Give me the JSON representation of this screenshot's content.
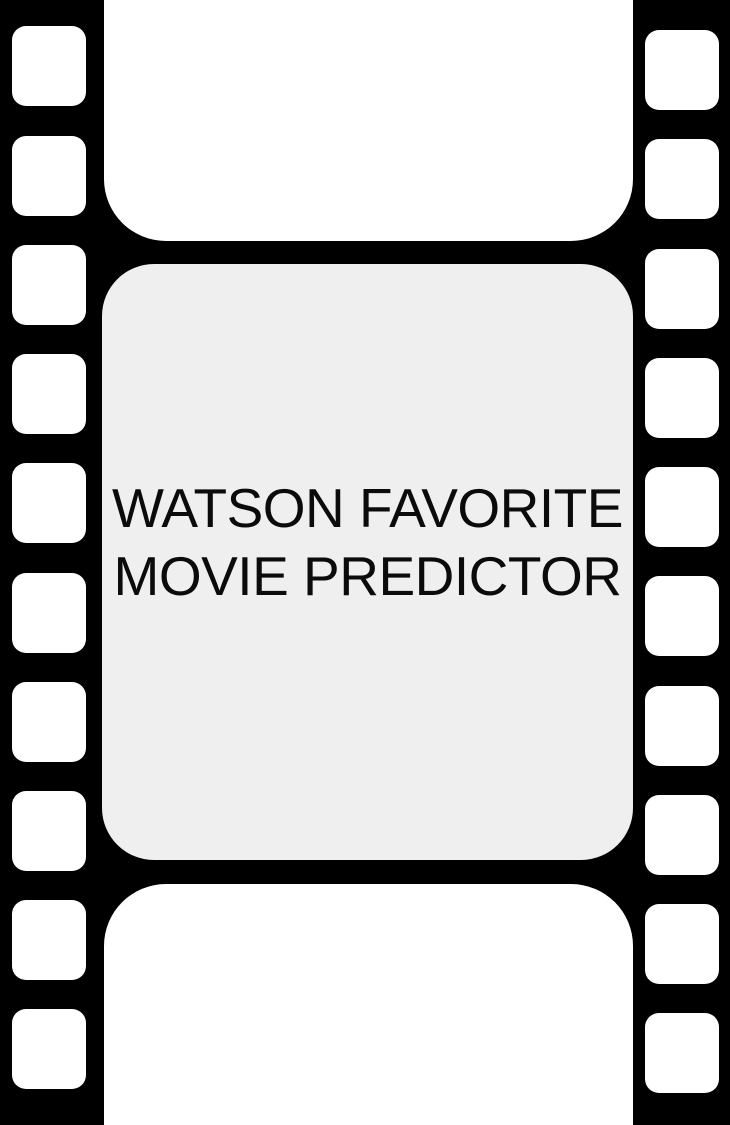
{
  "screen": {
    "title_lines": [
      "WATSON FAVORITE",
      "MOVIE PREDICTOR"
    ]
  },
  "colors": {
    "strip": "#000000",
    "frame": "#ffffff",
    "main_frame": "#efefef",
    "text": "#0b0b0b"
  },
  "icons": {
    "background": "film-strip-icon"
  }
}
